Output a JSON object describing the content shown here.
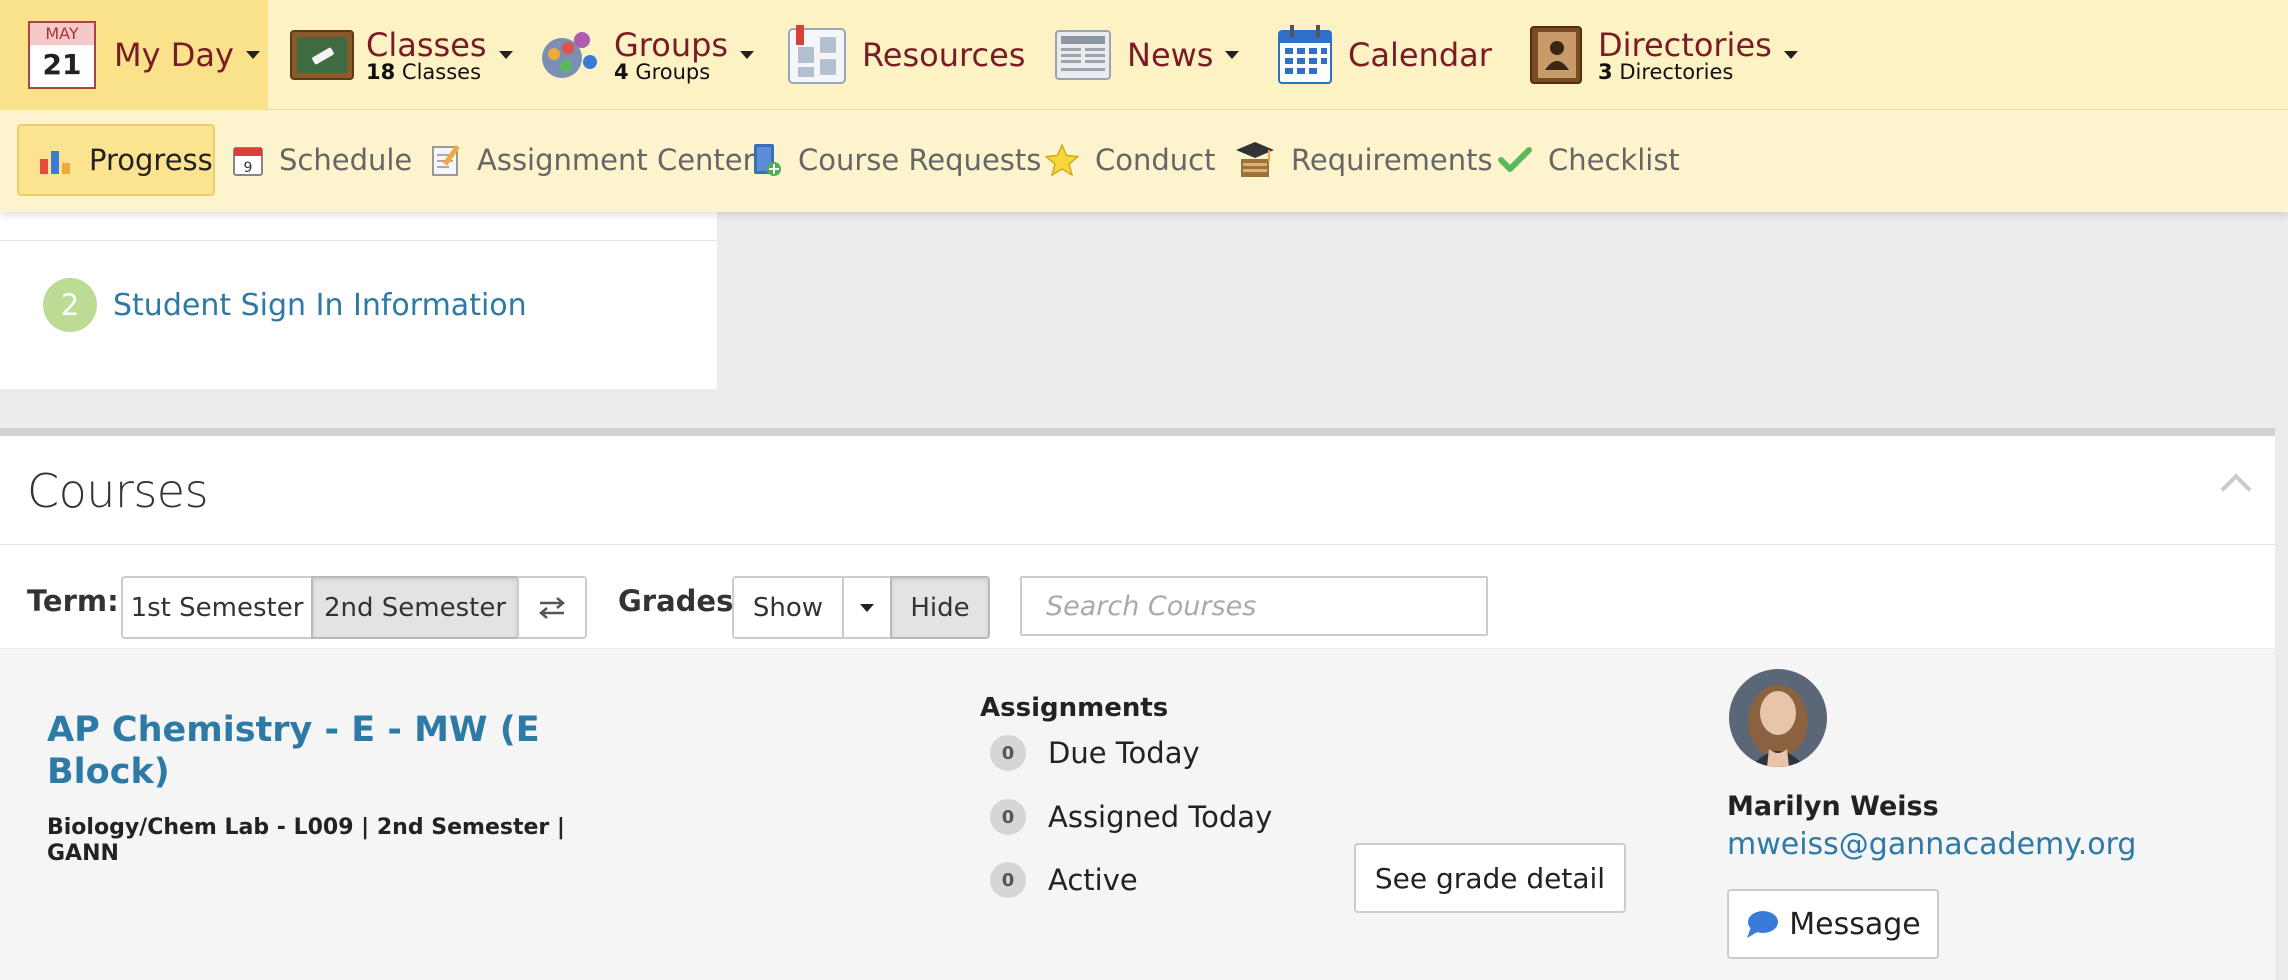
{
  "top_nav": {
    "myday": {
      "month": "MAY",
      "day": "21",
      "label": "My Day"
    },
    "classes": {
      "label": "Classes",
      "count": "18",
      "unit": "Classes"
    },
    "groups": {
      "label": "Groups",
      "count": "4",
      "unit": "Groups"
    },
    "resources": {
      "label": "Resources"
    },
    "news": {
      "label": "News"
    },
    "calendar": {
      "label": "Calendar"
    },
    "directories": {
      "label": "Directories",
      "count": "3",
      "unit": "Directories"
    }
  },
  "sub_nav": {
    "items": [
      {
        "label": "Progress",
        "icon": "bar-chart-icon",
        "active": true
      },
      {
        "label": "Schedule",
        "icon": "calendar-9-icon"
      },
      {
        "label": "Assignment Center",
        "icon": "notepad-icon"
      },
      {
        "label": "Course Requests",
        "icon": "book-add-icon"
      },
      {
        "label": "Conduct",
        "icon": "star-icon"
      },
      {
        "label": "Requirements",
        "icon": "mortarboard-icon"
      },
      {
        "label": "Checklist",
        "icon": "checkmark-icon"
      }
    ]
  },
  "steps": {
    "number": "2",
    "link": "Student Sign In Information"
  },
  "courses": {
    "title": "Courses",
    "term": {
      "label": "Term:",
      "options": [
        "1st Semester",
        "2nd Semester"
      ],
      "selected": "2nd Semester"
    },
    "grades": {
      "label": "Grades:",
      "show": "Show",
      "hide": "Hide",
      "selected": "Hide"
    },
    "search_placeholder": "Search Courses",
    "course": {
      "title": "AP Chemistry - E - MW (E Block)",
      "meta": "Biology/Chem Lab - L009 | 2nd Semester | GANN",
      "assignments_heading": "Assignments",
      "assignments": [
        {
          "count": "0",
          "label": "Due Today"
        },
        {
          "count": "0",
          "label": "Assigned Today"
        },
        {
          "count": "0",
          "label": "Active"
        }
      ],
      "grade_button": "See grade detail",
      "teacher": {
        "name": "Marilyn Weiss",
        "email": "mweiss@gannacademy.org",
        "message_button": "Message"
      }
    }
  },
  "colors": {
    "nav_bg": "#fdf2c3",
    "nav_active": "#f9e28a",
    "nav_text": "#7a1b26",
    "link": "#2e7aa6"
  }
}
